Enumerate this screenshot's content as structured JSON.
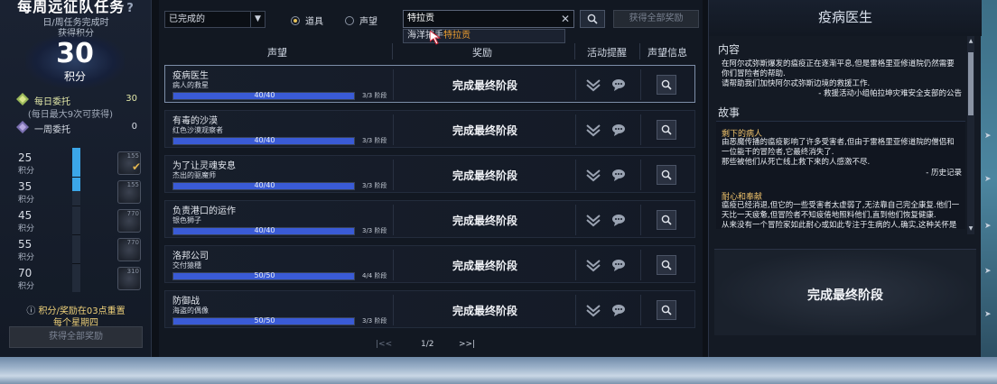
{
  "left": {
    "title": "每周远征队任务",
    "help": "?",
    "subtitle_1": "日/周任务完成时",
    "subtitle_2": "获得积分",
    "points_value": "30",
    "points_label": "积分",
    "daily": {
      "label": "每日委托",
      "value": "30",
      "note": "(每日最大9次可获得)"
    },
    "weekly": {
      "label": "一周委托",
      "value": "0"
    },
    "tiers": [
      {
        "points": "25",
        "label": "积分",
        "level": "155",
        "claimed": true
      },
      {
        "points": "35",
        "label": "积分",
        "level": "155",
        "claimed": false
      },
      {
        "points": "45",
        "label": "积分",
        "level": "770",
        "claimed": false
      },
      {
        "points": "55",
        "label": "积分",
        "level": "770",
        "claimed": false
      },
      {
        "points": "70",
        "label": "积分",
        "level": "310",
        "claimed": false
      }
    ],
    "progress_fraction": 0.3,
    "reset_line_1": "积分/奖励在03点重置",
    "reset_line_2": "每个星期四",
    "claim_all": "获得全部奖励"
  },
  "filter": {
    "dropdown_value": "已完成的",
    "radio_item": "道具",
    "radio_reputation": "声望",
    "search_value": "特拉贡",
    "suggestion_prefix": "海洋捕",
    "suggestion_mid": "手",
    "suggestion_highlight": "特拉贡",
    "claim_all": "获得全部奖励"
  },
  "table": {
    "headers": {
      "reputation": "声望",
      "reward": "奖励",
      "event": "活动提醒",
      "info": "声望信息"
    },
    "rows": [
      {
        "name": "疫病医生",
        "sub": "病人的救星",
        "progress": "40/40",
        "fraction": 1.0,
        "stage": "3/3 阶段",
        "reward": "完成最终阶段",
        "selected": true
      },
      {
        "name": "有毒的沙漠",
        "sub": "红色沙漠观察者",
        "progress": "40/40",
        "fraction": 1.0,
        "stage": "3/3 阶段",
        "reward": "完成最终阶段",
        "selected": false
      },
      {
        "name": "为了让灵魂安息",
        "sub": "杰出的驱魔师",
        "progress": "40/40",
        "fraction": 1.0,
        "stage": "3/3 阶段",
        "reward": "完成最终阶段",
        "selected": false
      },
      {
        "name": "负责港口的运作",
        "sub": "银色狮子",
        "progress": "40/40",
        "fraction": 1.0,
        "stage": "3/3 阶段",
        "reward": "完成最终阶段",
        "selected": false
      },
      {
        "name": "洛邦公司",
        "sub": "交付猿穗",
        "progress": "50/50",
        "fraction": 1.0,
        "stage": "4/4 阶段",
        "reward": "完成最终阶段",
        "selected": false
      },
      {
        "name": "防御战",
        "sub": "海盗的偶像",
        "progress": "50/50",
        "fraction": 1.0,
        "stage": "3/3 阶段",
        "reward": "完成最终阶段",
        "selected": false
      }
    ]
  },
  "pager": {
    "page": "1/2"
  },
  "detail": {
    "title": "疫病医生",
    "content_label": "内容",
    "content_lines": [
      "在阿尔忒弥斯爆发的瘟疫正在逐渐平息,但是雷格里亚修道院仍然需要",
      "你们冒险者的帮助.",
      "请帮助我们加快阿尔忒弥斯边境的救援工作."
    ],
    "content_sign": "- 救援活动小组帕拉坤灾难安全支部的公告",
    "story_label": "故事",
    "story1_title": "剩下的病人",
    "story1_lines": [
      "由恶魔传播的瘟疫影响了许多受害者,但由于雷格里亚修道院的僧侣和",
      "一位能干的冒险者,它最终消失了.",
      "那些被他们从死亡线上救下来的人感激不尽."
    ],
    "story1_sign": "- 历史记录",
    "story2_title": "耐心和奉献",
    "story2_lines": [
      "瘟疫已经消退,但它的一些受害者太虚弱了,无法靠自己完全康复.他们一",
      "天比一天疲惫,但冒险者不知疲倦地照料他们,直到他们恢复健康.",
      "从来没有一个冒险家如此耐心或如此专注于生病的人,确实,这种关怀是"
    ],
    "final_button": "完成最终阶段"
  },
  "colors": {
    "accent_blue": "#3a5bd6",
    "gold": "#f0c36b",
    "bar_blue": "#3ba6e8"
  }
}
